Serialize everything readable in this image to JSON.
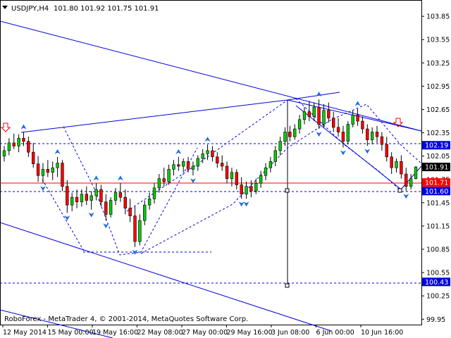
{
  "header": {
    "symbol": "USDJPY,H4",
    "ohlc": "101.80 101.92 101.75 101.91"
  },
  "footer": {
    "copyright": "RoboForex - MetaTrader 4, © 2001-2014, MetaQuotes Software Corp."
  },
  "colors": {
    "bull": "#00cc00",
    "bear": "#ff0000",
    "wick": "#000000",
    "line": "#0000dd",
    "arrow": "#1e6ee0",
    "level_red": "#ff0000",
    "tag_blue": "#0000dd",
    "tag_black": "#000000"
  },
  "chart_data": {
    "type": "candlestick",
    "symbol": "USDJPY",
    "timeframe": "H4",
    "ylim": [
      99.88,
      104.06
    ],
    "y_ticks": [
      "103.85",
      "103.55",
      "103.25",
      "102.95",
      "102.65",
      "102.35",
      "102.05",
      "101.75",
      "101.45",
      "101.15",
      "100.85",
      "100.55",
      "100.25",
      "99.95"
    ],
    "x_ticks": [
      "12 May 2014",
      "15 May 00:00",
      "19 May 16:00",
      "22 May 08:00",
      "27 May 00:00",
      "29 May 16:00",
      "3 Jun 08:00",
      "6 Jun 00:00",
      "10 Jun 16:00"
    ],
    "price_tags": [
      {
        "label": "102.19",
        "value": 102.19,
        "color": "tag_blue"
      },
      {
        "label": "101.91",
        "value": 101.91,
        "color": "tag_black"
      },
      {
        "label": "101.71",
        "value": 101.71,
        "color": "bear"
      },
      {
        "label": "101.60",
        "value": 101.6,
        "color": "tag_blue"
      },
      {
        "label": "100.43",
        "value": 100.43,
        "color": "tag_blue"
      }
    ],
    "series": [
      {
        "open": 102.05,
        "high": 102.18,
        "low": 101.98,
        "close": 102.12
      },
      {
        "open": 102.12,
        "high": 102.28,
        "low": 102.06,
        "close": 102.22
      },
      {
        "open": 102.22,
        "high": 102.34,
        "low": 102.14,
        "close": 102.18
      },
      {
        "open": 102.18,
        "high": 102.33,
        "low": 102.1,
        "close": 102.28
      },
      {
        "open": 102.28,
        "high": 102.36,
        "low": 102.18,
        "close": 102.24
      },
      {
        "open": 102.24,
        "high": 102.3,
        "low": 102.04,
        "close": 102.1
      },
      {
        "open": 102.1,
        "high": 102.22,
        "low": 101.9,
        "close": 101.95
      },
      {
        "open": 101.95,
        "high": 102.05,
        "low": 101.72,
        "close": 101.8
      },
      {
        "open": 101.8,
        "high": 101.96,
        "low": 101.7,
        "close": 101.88
      },
      {
        "open": 101.88,
        "high": 102.0,
        "low": 101.78,
        "close": 101.84
      },
      {
        "open": 101.84,
        "high": 101.98,
        "low": 101.74,
        "close": 101.9
      },
      {
        "open": 101.9,
        "high": 102.04,
        "low": 101.78,
        "close": 101.96
      },
      {
        "open": 101.96,
        "high": 102.0,
        "low": 101.6,
        "close": 101.66
      },
      {
        "open": 101.66,
        "high": 101.74,
        "low": 101.32,
        "close": 101.42
      },
      {
        "open": 101.42,
        "high": 101.58,
        "low": 101.34,
        "close": 101.52
      },
      {
        "open": 101.52,
        "high": 101.62,
        "low": 101.38,
        "close": 101.46
      },
      {
        "open": 101.46,
        "high": 101.62,
        "low": 101.4,
        "close": 101.56
      },
      {
        "open": 101.56,
        "high": 101.66,
        "low": 101.42,
        "close": 101.48
      },
      {
        "open": 101.48,
        "high": 101.6,
        "low": 101.36,
        "close": 101.54
      },
      {
        "open": 101.54,
        "high": 101.7,
        "low": 101.48,
        "close": 101.62
      },
      {
        "open": 101.62,
        "high": 101.68,
        "low": 101.4,
        "close": 101.46
      },
      {
        "open": 101.46,
        "high": 101.56,
        "low": 101.22,
        "close": 101.3
      },
      {
        "open": 101.3,
        "high": 101.52,
        "low": 101.26,
        "close": 101.48
      },
      {
        "open": 101.48,
        "high": 101.64,
        "low": 101.42,
        "close": 101.58
      },
      {
        "open": 101.58,
        "high": 101.7,
        "low": 101.46,
        "close": 101.52
      },
      {
        "open": 101.52,
        "high": 101.62,
        "low": 101.3,
        "close": 101.38
      },
      {
        "open": 101.38,
        "high": 101.5,
        "low": 101.2,
        "close": 101.28
      },
      {
        "open": 101.28,
        "high": 101.4,
        "low": 100.88,
        "close": 100.95
      },
      {
        "open": 100.95,
        "high": 101.3,
        "low": 100.9,
        "close": 101.22
      },
      {
        "open": 101.22,
        "high": 101.48,
        "low": 101.16,
        "close": 101.42
      },
      {
        "open": 101.42,
        "high": 101.58,
        "low": 101.36,
        "close": 101.5
      },
      {
        "open": 101.5,
        "high": 101.7,
        "low": 101.44,
        "close": 101.64
      },
      {
        "open": 101.64,
        "high": 101.82,
        "low": 101.58,
        "close": 101.76
      },
      {
        "open": 101.76,
        "high": 101.9,
        "low": 101.66,
        "close": 101.72
      },
      {
        "open": 101.72,
        "high": 101.94,
        "low": 101.68,
        "close": 101.88
      },
      {
        "open": 101.88,
        "high": 102.0,
        "low": 101.8,
        "close": 101.94
      },
      {
        "open": 101.94,
        "high": 102.04,
        "low": 101.86,
        "close": 101.92
      },
      {
        "open": 101.92,
        "high": 102.02,
        "low": 101.84,
        "close": 101.98
      },
      {
        "open": 101.98,
        "high": 102.04,
        "low": 101.84,
        "close": 101.88
      },
      {
        "open": 101.88,
        "high": 101.98,
        "low": 101.8,
        "close": 101.92
      },
      {
        "open": 101.92,
        "high": 102.06,
        "low": 101.86,
        "close": 102.02
      },
      {
        "open": 102.02,
        "high": 102.14,
        "low": 101.96,
        "close": 102.08
      },
      {
        "open": 102.08,
        "high": 102.2,
        "low": 102.0,
        "close": 102.12
      },
      {
        "open": 102.12,
        "high": 102.18,
        "low": 101.98,
        "close": 102.04
      },
      {
        "open": 102.04,
        "high": 102.1,
        "low": 101.9,
        "close": 101.96
      },
      {
        "open": 101.96,
        "high": 102.06,
        "low": 101.86,
        "close": 101.92
      },
      {
        "open": 101.92,
        "high": 101.98,
        "low": 101.7,
        "close": 101.76
      },
      {
        "open": 101.76,
        "high": 101.9,
        "low": 101.66,
        "close": 101.84
      },
      {
        "open": 101.84,
        "high": 101.88,
        "low": 101.62,
        "close": 101.68
      },
      {
        "open": 101.68,
        "high": 101.78,
        "low": 101.5,
        "close": 101.56
      },
      {
        "open": 101.56,
        "high": 101.72,
        "low": 101.5,
        "close": 101.66
      },
      {
        "open": 101.66,
        "high": 101.74,
        "low": 101.52,
        "close": 101.6
      },
      {
        "open": 101.6,
        "high": 101.76,
        "low": 101.56,
        "close": 101.7
      },
      {
        "open": 101.7,
        "high": 101.86,
        "low": 101.64,
        "close": 101.8
      },
      {
        "open": 101.8,
        "high": 101.96,
        "low": 101.74,
        "close": 101.9
      },
      {
        "open": 101.9,
        "high": 102.04,
        "low": 101.84,
        "close": 101.98
      },
      {
        "open": 101.98,
        "high": 102.18,
        "low": 101.92,
        "close": 102.12
      },
      {
        "open": 102.12,
        "high": 102.3,
        "low": 102.06,
        "close": 102.24
      },
      {
        "open": 102.24,
        "high": 102.42,
        "low": 102.18,
        "close": 102.36
      },
      {
        "open": 102.36,
        "high": 102.44,
        "low": 102.24,
        "close": 102.3
      },
      {
        "open": 102.3,
        "high": 102.46,
        "low": 102.26,
        "close": 102.4
      },
      {
        "open": 102.4,
        "high": 102.58,
        "low": 102.34,
        "close": 102.52
      },
      {
        "open": 102.52,
        "high": 102.68,
        "low": 102.46,
        "close": 102.62
      },
      {
        "open": 102.62,
        "high": 102.76,
        "low": 102.5,
        "close": 102.56
      },
      {
        "open": 102.56,
        "high": 102.74,
        "low": 102.5,
        "close": 102.68
      },
      {
        "open": 102.68,
        "high": 102.78,
        "low": 102.4,
        "close": 102.46
      },
      {
        "open": 102.46,
        "high": 102.72,
        "low": 102.42,
        "close": 102.64
      },
      {
        "open": 102.64,
        "high": 102.74,
        "low": 102.48,
        "close": 102.54
      },
      {
        "open": 102.54,
        "high": 102.62,
        "low": 102.36,
        "close": 102.42
      },
      {
        "open": 102.42,
        "high": 102.54,
        "low": 102.3,
        "close": 102.36
      },
      {
        "open": 102.36,
        "high": 102.44,
        "low": 102.16,
        "close": 102.24
      },
      {
        "open": 102.24,
        "high": 102.5,
        "low": 102.2,
        "close": 102.46
      },
      {
        "open": 102.46,
        "high": 102.64,
        "low": 102.42,
        "close": 102.58
      },
      {
        "open": 102.58,
        "high": 102.66,
        "low": 102.44,
        "close": 102.5
      },
      {
        "open": 102.5,
        "high": 102.56,
        "low": 102.34,
        "close": 102.4
      },
      {
        "open": 102.4,
        "high": 102.46,
        "low": 102.18,
        "close": 102.26
      },
      {
        "open": 102.26,
        "high": 102.42,
        "low": 102.2,
        "close": 102.36
      },
      {
        "open": 102.36,
        "high": 102.44,
        "low": 102.22,
        "close": 102.3
      },
      {
        "open": 102.3,
        "high": 102.36,
        "low": 102.12,
        "close": 102.2
      },
      {
        "open": 102.2,
        "high": 102.3,
        "low": 101.98,
        "close": 102.04
      },
      {
        "open": 102.04,
        "high": 102.1,
        "low": 101.82,
        "close": 101.9
      },
      {
        "open": 101.9,
        "high": 102.02,
        "low": 101.84,
        "close": 101.98
      },
      {
        "open": 101.98,
        "high": 102.06,
        "low": 101.76,
        "close": 101.82
      },
      {
        "open": 101.82,
        "high": 101.9,
        "low": 101.6,
        "close": 101.66
      },
      {
        "open": 101.66,
        "high": 101.82,
        "low": 101.62,
        "close": 101.76
      },
      {
        "open": 101.76,
        "high": 101.92,
        "low": 101.75,
        "close": 101.91
      }
    ]
  }
}
